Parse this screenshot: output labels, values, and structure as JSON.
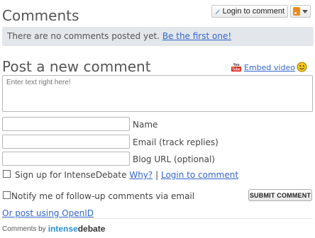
{
  "header": {
    "title": "Comments",
    "login_button": "Login to comment"
  },
  "notice": {
    "text": "There are no comments posted yet.",
    "link": "Be the first one!"
  },
  "post": {
    "title": "Post a new comment",
    "embed_video": "Embed video",
    "textarea_placeholder": "Enter text right here!"
  },
  "fields": {
    "name_label": "Name",
    "email_label": "Email (track replies)",
    "url_label": "Blog URL (optional)",
    "name_value": "",
    "email_value": "",
    "url_value": ""
  },
  "signup": {
    "label": "Sign up for IntenseDebate",
    "why": "Why?",
    "separator": "|",
    "login": "Login to comment"
  },
  "notify": {
    "label": "Notify me of follow-up comments via email",
    "submit": "SUBMIT COMMENT"
  },
  "openid": "Or post using OpenID",
  "footer": {
    "prefix": "Comments by",
    "brand_part1": "intense",
    "brand_part2": "debate"
  },
  "colors": {
    "link": "#3366cc",
    "notice_bg": "#e3e6ea",
    "brand_blue": "#2a8fd6"
  }
}
